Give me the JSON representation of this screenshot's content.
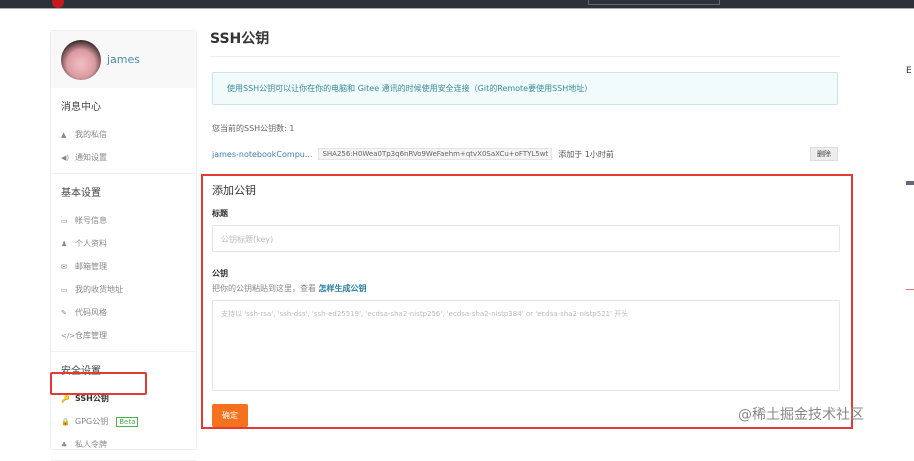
{
  "topbar": {
    "search_placeholder": ""
  },
  "sidebar": {
    "username": "james",
    "sections": [
      {
        "title": "消息中心",
        "items": [
          {
            "icon": "bell-icon",
            "glyph": "▲",
            "label": "我的私信"
          },
          {
            "icon": "speaker-icon",
            "glyph": "◀)",
            "label": "通知设置"
          }
        ]
      },
      {
        "title": "基本设置",
        "items": [
          {
            "icon": "card-icon",
            "glyph": "▭",
            "label": "帐号信息"
          },
          {
            "icon": "user-icon",
            "glyph": "♟",
            "label": "个人资料"
          },
          {
            "icon": "mail-icon",
            "glyph": "✉",
            "label": "邮箱管理"
          },
          {
            "icon": "address-icon",
            "glyph": "▭",
            "label": "我的收货地址"
          },
          {
            "icon": "brush-icon",
            "glyph": "✎",
            "label": "代码风格"
          },
          {
            "icon": "code-icon",
            "glyph": "</>",
            "label": "仓库管理"
          }
        ]
      },
      {
        "title": "安全设置",
        "items": [
          {
            "icon": "key-icon",
            "glyph": "🔑",
            "label": "SSH公钥",
            "active": true
          },
          {
            "icon": "lock-icon",
            "glyph": "🔒",
            "label": "GPG公钥",
            "badge": "Beta"
          },
          {
            "icon": "token-icon",
            "glyph": "♣",
            "label": "私人令牌"
          }
        ]
      }
    ]
  },
  "main": {
    "title": "SSH公钥",
    "info": "使用SSH公钥可以让你在你的电脑和 Gitee 通讯的时候使用安全连接（Git的Remote要使用SSH地址）",
    "count": "您当前的SSH公钥数: 1",
    "key": {
      "name": "james-notebookCompu...",
      "fingerprint": "SHA256:H0Wea0Tp3q6nRVo9WeFaehm+qtvX0SaXCu+oFTYL5wt",
      "added": "添加于 1小时前",
      "delete_label": "删除"
    },
    "form": {
      "heading": "添加公钥",
      "title_label": "标题",
      "title_placeholder": "公钥标题(key)",
      "key_label": "公钥",
      "key_desc": "把你的公钥粘贴到这里，查看",
      "key_link": "怎样生成公钥",
      "key_placeholder": "支持以 'ssh-rsa', 'ssh-dss', 'ssh-ed25519', 'ecdsa-sha2-nistp256', 'ecdsa-sha2-nistp384' or 'ecdsa-sha2-nistp521' 开头",
      "submit_label": "确定"
    }
  },
  "right_edge_char": "E",
  "watermark": "@稀土掘金技术社区",
  "colors": {
    "accent": "#f4721d",
    "highlight": "#e53935",
    "link": "#2a7ea0"
  }
}
